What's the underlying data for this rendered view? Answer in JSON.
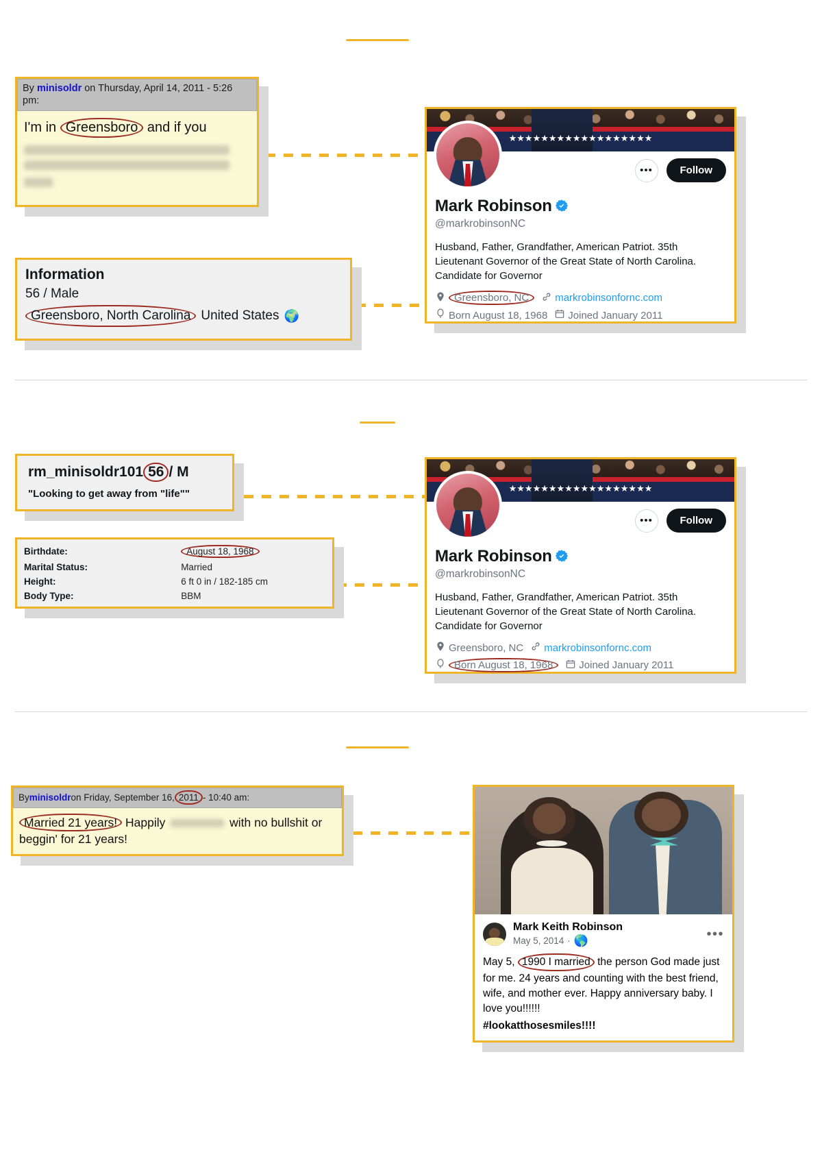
{
  "sections": [
    {
      "id": "section-1",
      "forum_post": {
        "header_prefix": "By ",
        "author": "minisoldr",
        "header_rest": " on Thursday, April 14, 2011 - 5:26 pm:",
        "body_prefix": "I'm in ",
        "highlight": "Greensboro",
        "body_suffix": " and if you"
      },
      "info_card": {
        "title": "Information",
        "age_gender": "56 / Male",
        "location_highlight": "Greensboro, North Carolina",
        "country": "United States",
        "globe_icon": "globe-icon"
      },
      "profile": {
        "display_name": "Mark Robinson",
        "verified_icon": "verified-badge-icon",
        "handle": "@markrobinsonNC",
        "bio": "Husband, Father, Grandfather, American Patriot. 35th Lieutenant Governor of the Great State of North Carolina. Candidate for Governor",
        "location": "Greensboro, NC",
        "website": "markrobinsonfornc.com",
        "born": "Born August 18, 1968",
        "joined": "Joined January 2011",
        "follow_label": "Follow",
        "more_label": "•••",
        "highlighted_field": "location"
      }
    },
    {
      "id": "section-2",
      "username_card": {
        "username": "rm_minisoldr101",
        "age_highlight": "56",
        "age_suffix": " / M",
        "tagline": "\"Looking to get away from \"life\"\""
      },
      "details": {
        "rows": [
          {
            "label": "Birthdate:",
            "value": "August 18, 1968",
            "highlighted": true
          },
          {
            "label": "Marital Status:",
            "value": "Married",
            "highlighted": false
          },
          {
            "label": "Height:",
            "value": "6 ft 0 in / 182-185 cm",
            "highlighted": false
          },
          {
            "label": "Body Type:",
            "value": "BBM",
            "highlighted": false
          }
        ]
      },
      "profile": {
        "display_name": "Mark Robinson",
        "verified_icon": "verified-badge-icon",
        "handle": "@markrobinsonNC",
        "bio": "Husband, Father, Grandfather, American Patriot. 35th Lieutenant Governor of the Great State of North Carolina. Candidate for Governor",
        "location": "Greensboro, NC",
        "website": "markrobinsonfornc.com",
        "born": "Born August 18, 1968",
        "joined": "Joined January 2011",
        "follow_label": "Follow",
        "more_label": "•••",
        "highlighted_field": "born"
      }
    },
    {
      "id": "section-3",
      "forum_post": {
        "header_prefix": "By ",
        "author": "minisoldr",
        "header_mid": " on Friday, September 16, ",
        "header_year": "2011",
        "header_rest": " - 10:40 am:",
        "highlight": "Married 21 years!",
        "body_part_1": " Happily ",
        "body_part_2": " with no bullshit or beggin' for 21 years!"
      },
      "facebook_post": {
        "author": "Mark Keith Robinson",
        "date": "May 5, 2014",
        "privacy_icon": "globe-icon",
        "separator": "·",
        "more_icon": "more-horizontal-icon",
        "text_prefix": "May 5, ",
        "text_highlight": "1990 I married",
        "text_rest": " the person God made just for me. 24 years and counting with the best friend, wife, and mother ever. Happy anniversary baby. I love you!!!!!!",
        "hashtag": "#lookatthosesmiles",
        "hashtag_suffix": "!!!!"
      }
    }
  ],
  "colors": {
    "accent": "#f0b429",
    "annotation": "#9e2b20",
    "twitter_blue": "#1d9bf0",
    "post_yellow": "#fbf9d5",
    "post_header_grey": "#bfbfbf",
    "card_grey": "#f0f0f0",
    "link_blue": "#1414c8"
  }
}
